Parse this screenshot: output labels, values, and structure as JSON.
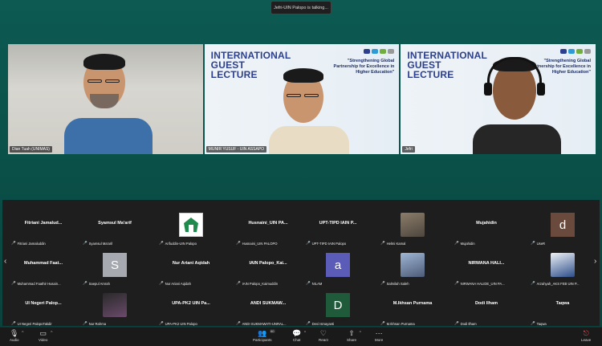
{
  "talking_indicator": "Jefri-UIN Palopo is talking...",
  "speakers": [
    {
      "name": "Dian Tuah (UNIMAS)"
    },
    {
      "name": "MUNIR YUSUF - UIN ASSAPO",
      "slide_title": "INTERNATIONAL GUEST LECTURE",
      "slide_subtitle": "\"Strengthening Global Partnership for Excellence in Higher Education\""
    },
    {
      "name": "Jefri",
      "slide_title": "INTERNATIONAL GUEST LECTURE",
      "slide_subtitle": "\"Strengthening Global Partnership for Excellence in Higher Education\""
    }
  ],
  "gallery": {
    "rows": [
      [
        {
          "title": "Fitriani Jamalud...",
          "label": "Fitriani Jamaluddin",
          "avatar": null
        },
        {
          "title": "Syamsul Ma'arif",
          "label": "Syamsul Ma'arif",
          "avatar": null
        },
        {
          "title": "",
          "label": "Arifuddin-UIN Palopo",
          "avatar": "logo"
        },
        {
          "title": "Husnaini_UIN PA...",
          "label": "Husnaini_UIN PALOPO",
          "avatar": null
        },
        {
          "title": "UPT-TIPD IAIN P...",
          "label": "UPT-TIPD IAIN Palopo",
          "avatar": null
        },
        {
          "title": "",
          "label": "Helmi Kamal",
          "avatar": "photo"
        },
        {
          "title": "Mujahidin",
          "label": "Mujahidin",
          "avatar": null
        },
        {
          "title": "",
          "label": "UseR",
          "avatar": "d"
        }
      ],
      [
        {
          "title": "Muhammad Faat...",
          "label": "Muhammad Faathir Husain...",
          "avatar": null
        },
        {
          "title": "",
          "label": "Saepul Amrah",
          "avatar": "S"
        },
        {
          "title": "Nur Ariani Aqidah",
          "label": "Nur Ariani Aqidah",
          "avatar": null
        },
        {
          "title": "IAIN Palopo_Kai...",
          "label": "IAIN Palopo_Kaimuddin",
          "avatar": null
        },
        {
          "title": "",
          "label": "NILAM",
          "avatar": "a"
        },
        {
          "title": "",
          "label": "Salmilah Saleh",
          "avatar": "photo2"
        },
        {
          "title": "NIRWANA HALI...",
          "label": "NIRWANA HALIDE_UIN PA...",
          "avatar": null
        },
        {
          "title": "",
          "label": "Arzahyah_AKS FEB UIN P...",
          "avatar": "photo3"
        }
      ],
      [
        {
          "title": "UI Negeri Palop...",
          "label": "UI Negeri PalopoTakdir",
          "avatar": null
        },
        {
          "title": "",
          "label": "Nur Rahma",
          "avatar": "photo4"
        },
        {
          "title": "UPA-PK2 UIN Pa...",
          "label": "UPA-PK2 UIN Palopo",
          "avatar": null
        },
        {
          "title": "ANDI SUKMAW...",
          "label": "ANDI SUKMAWATI-UNRAL...",
          "avatar": null
        },
        {
          "title": "",
          "label": "Devi Ismayanti",
          "avatar": "D"
        },
        {
          "title": "M.Ikhsan Purnama",
          "label": "M.Ikhsan Purnama",
          "avatar": null
        },
        {
          "title": "Dodi Ilham",
          "label": "Dodi Ilham",
          "avatar": null
        },
        {
          "title": "Taqwa",
          "label": "Taqwa",
          "avatar": null
        }
      ]
    ]
  },
  "toolbar": {
    "audio": "Audio",
    "video": "Video",
    "participants": "Participants",
    "participants_count": "60",
    "chat": "Chat",
    "react": "React",
    "share": "Share",
    "more": "More",
    "leave": "Leave"
  },
  "colors": {
    "avatar_d": "#6b4a3e",
    "avatar_s": "#a6aab0",
    "avatar_a": "#5b5bb8",
    "avatar_D": "#1f5a3a"
  }
}
